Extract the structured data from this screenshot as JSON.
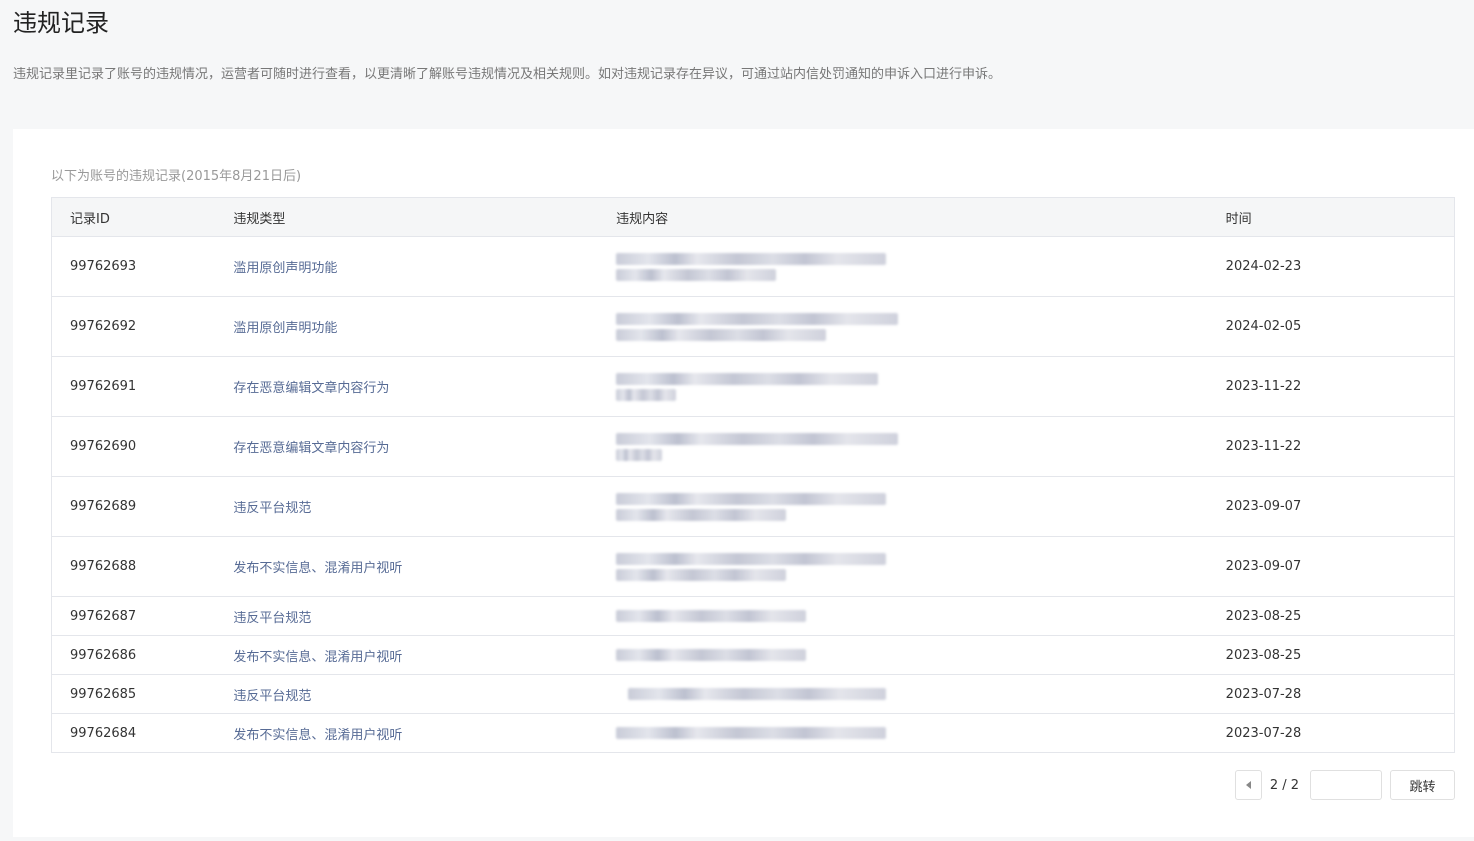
{
  "header": {
    "title": "违规记录",
    "description": "违规记录里记录了账号的违规情况，运营者可随时进行查看，以更清晰了解账号违规情况及相关规则。如对违规记录存在异议，可通过站内信处罚通知的申诉入口进行申诉。"
  },
  "table": {
    "caption": "以下为账号的违规记录(2015年8月21日后)",
    "columns": [
      "记录ID",
      "违规类型",
      "违规内容",
      "时间"
    ],
    "rows": [
      {
        "id": "99762693",
        "type": "滥用原创声明功能",
        "time": "2024-02-23"
      },
      {
        "id": "99762692",
        "type": "滥用原创声明功能",
        "time": "2024-02-05"
      },
      {
        "id": "99762691",
        "type": "存在恶意编辑文章内容行为",
        "time": "2023-11-22"
      },
      {
        "id": "99762690",
        "type": "存在恶意编辑文章内容行为",
        "time": "2023-11-22"
      },
      {
        "id": "99762689",
        "type": "违反平台规范",
        "time": "2023-09-07"
      },
      {
        "id": "99762688",
        "type": "发布不实信息、混淆用户视听",
        "time": "2023-09-07"
      },
      {
        "id": "99762687",
        "type": "违反平台规范",
        "time": "2023-08-25"
      },
      {
        "id": "99762686",
        "type": "发布不实信息、混淆用户视听",
        "time": "2023-08-25"
      },
      {
        "id": "99762685",
        "type": "违反平台规范",
        "time": "2023-07-28"
      },
      {
        "id": "99762684",
        "type": "发布不实信息、混淆用户视听",
        "time": "2023-07-28"
      }
    ]
  },
  "pager": {
    "info": "2 / 2",
    "input_value": "",
    "go_label": "跳转"
  },
  "colors": {
    "type_link": "#576b95",
    "background": "#f6f7f8"
  }
}
